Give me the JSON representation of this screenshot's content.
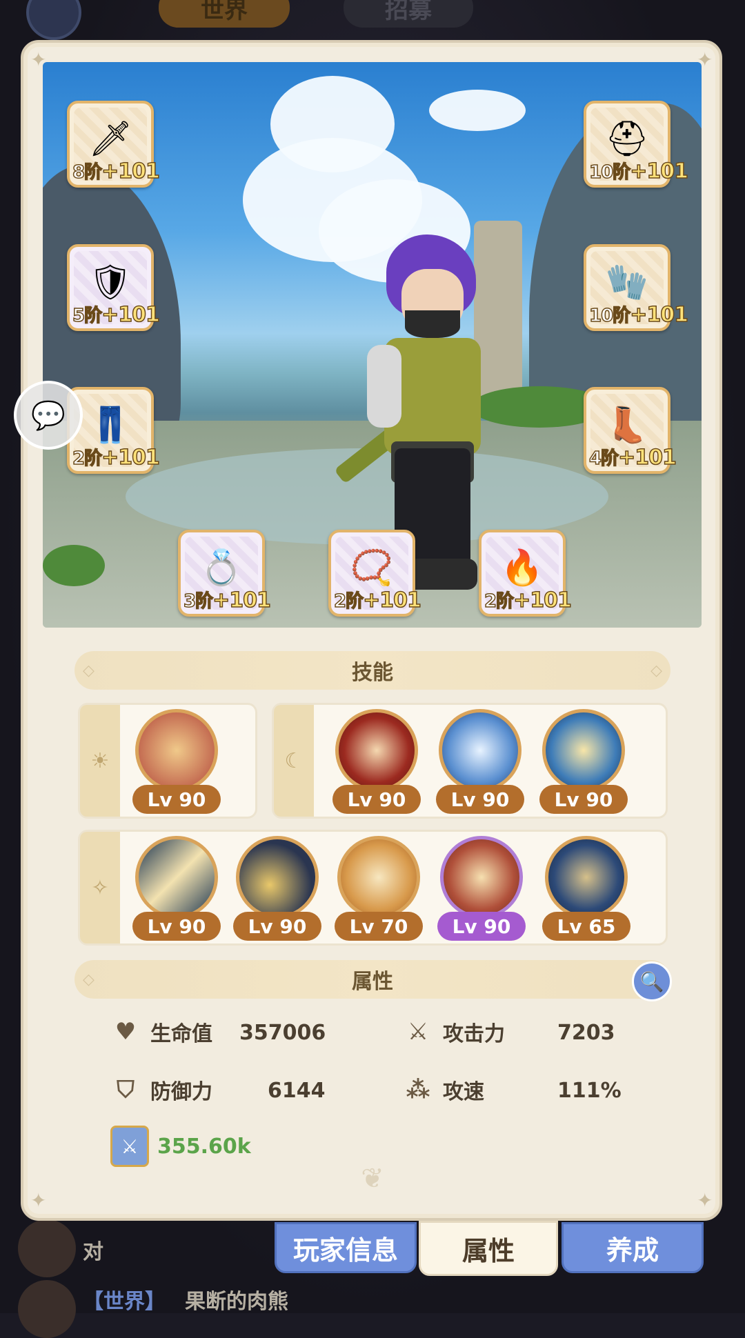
{
  "top_bar": {
    "world_tab": "世界",
    "recruit_tab": "招募"
  },
  "chat_button": {
    "icon": "chat-bubble-icon"
  },
  "equipment": {
    "left": [
      {
        "name": "weapon",
        "tier": "8阶",
        "enhance": "+101",
        "icon": "sword-icon"
      },
      {
        "name": "armor",
        "tier": "5阶",
        "enhance": "+101",
        "icon": "armor-icon"
      },
      {
        "name": "pants",
        "tier": "2阶",
        "enhance": "+101",
        "icon": "pants-icon"
      }
    ],
    "right": [
      {
        "name": "helmet",
        "tier": "10阶",
        "enhance": "+101",
        "icon": "helmet-icon"
      },
      {
        "name": "gloves",
        "tier": "10阶",
        "enhance": "+101",
        "icon": "gauntlet-icon"
      },
      {
        "name": "boots",
        "tier": "4阶",
        "enhance": "+101",
        "icon": "boots-icon"
      }
    ],
    "bottom": [
      {
        "name": "ring",
        "tier": "3阶",
        "enhance": "+101",
        "icon": "ring-icon"
      },
      {
        "name": "necklace",
        "tier": "2阶",
        "enhance": "+101",
        "icon": "necklace-icon"
      },
      {
        "name": "charm",
        "tier": "2阶",
        "enhance": "+101",
        "icon": "pendant-icon"
      }
    ]
  },
  "skills": {
    "header": "技能",
    "passive": [
      {
        "level": "Lv 90",
        "icon": "star-burst-skill-icon"
      }
    ],
    "moon": [
      {
        "level": "Lv 90",
        "icon": "vortex-skill-icon"
      },
      {
        "level": "Lv 90",
        "icon": "radiant-hero-skill-icon"
      },
      {
        "level": "Lv 90",
        "icon": "flame-hero-skill-icon"
      }
    ],
    "active": [
      {
        "level": "Lv 90",
        "icon": "blade-slash-skill-icon"
      },
      {
        "level": "Lv 90",
        "icon": "crescent-skill-icon"
      },
      {
        "level": "Lv 70",
        "icon": "eye-burst-skill-icon"
      },
      {
        "level": "Lv 90",
        "icon": "whirl-strike-skill-icon",
        "rare": true
      },
      {
        "level": "Lv 65",
        "icon": "hawk-eye-skill-icon"
      }
    ]
  },
  "attributes": {
    "header": "属性",
    "hp_label": "生命值",
    "hp_value": "357006",
    "atk_label": "攻击力",
    "atk_value": "7203",
    "def_label": "防御力",
    "def_value": "6144",
    "spd_label": "攻速",
    "spd_value": "111%",
    "power_value": "355.60k"
  },
  "bottom_tabs": {
    "player_info": "玩家信息",
    "attributes": "属性",
    "cultivate": "养成"
  },
  "chat": {
    "line1": "对",
    "line2_channel": "【世界】",
    "line2_name": "果断的肉熊"
  },
  "colors": {
    "accent_blue": "#6f8fdc",
    "level_brown": "#b36e2c",
    "level_purple": "#a55bd0",
    "power_green": "#5ba44a"
  }
}
